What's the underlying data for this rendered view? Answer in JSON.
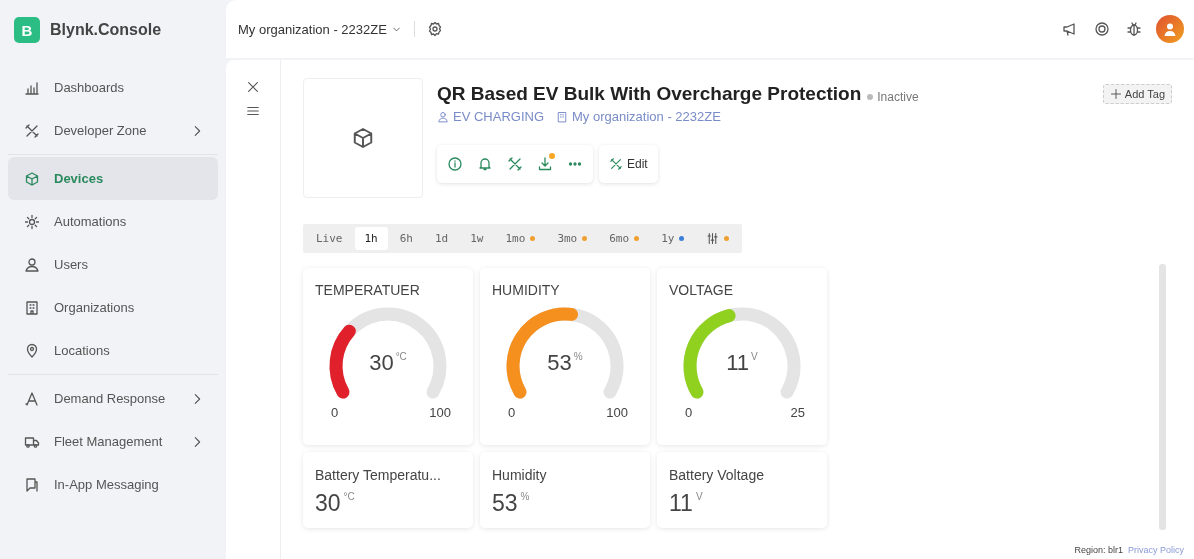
{
  "brand": {
    "logo_letter": "B",
    "name": "Blynk.Console"
  },
  "topbar": {
    "organization": "My organization - 2232ZE"
  },
  "sidebar": {
    "groups": [
      {
        "items": [
          {
            "label": "Dashboards",
            "selected": false,
            "submenu": false
          },
          {
            "label": "Developer Zone",
            "selected": false,
            "submenu": true
          }
        ]
      },
      {
        "items": [
          {
            "label": "Devices",
            "selected": true,
            "submenu": false
          },
          {
            "label": "Automations",
            "selected": false,
            "submenu": false
          },
          {
            "label": "Users",
            "selected": false,
            "submenu": false
          },
          {
            "label": "Organizations",
            "selected": false,
            "submenu": false
          },
          {
            "label": "Locations",
            "selected": false,
            "submenu": false
          }
        ]
      },
      {
        "items": [
          {
            "label": "Demand Response",
            "selected": false,
            "submenu": true
          },
          {
            "label": "Fleet Management",
            "selected": false,
            "submenu": true
          },
          {
            "label": "In-App Messaging",
            "selected": false,
            "submenu": false
          }
        ]
      }
    ]
  },
  "device": {
    "title": "QR Based EV Bulk With Overcharge Protection",
    "status": "Inactive",
    "template": "EV CHARGING",
    "organization": "My organization - 2232ZE",
    "add_tag": "Add Tag",
    "toolbar": [
      {
        "badge": false
      },
      {
        "badge": false
      },
      {
        "badge": false
      },
      {
        "badge": true
      },
      {
        "badge": false
      }
    ],
    "edit": "Edit"
  },
  "time_ranges": [
    {
      "kind": "text",
      "label": "Live",
      "selected": false
    },
    {
      "kind": "text",
      "label": "1h",
      "selected": true
    },
    {
      "kind": "text",
      "label": "6h",
      "selected": false
    },
    {
      "kind": "text",
      "label": "1d",
      "selected": false
    },
    {
      "kind": "text",
      "label": "1w",
      "selected": false
    },
    {
      "kind": "text",
      "label": "1mo",
      "selected": false,
      "color": "#f0a030"
    },
    {
      "kind": "text",
      "label": "3mo",
      "selected": false,
      "color": "#f0a030"
    },
    {
      "kind": "text",
      "label": "6mo",
      "selected": false,
      "color": "#f0a030"
    },
    {
      "kind": "text",
      "label": "1y",
      "selected": false,
      "color": "#3a7fd8"
    },
    {
      "kind": "icon",
      "selected": false,
      "color": "#f0a030"
    }
  ],
  "gauges": [
    {
      "title": "TEMPERATUER",
      "value": "30",
      "unit": "°C",
      "min": "0",
      "max": "100",
      "color": "#e0202a"
    },
    {
      "title": "HUMIDITY",
      "value": "53",
      "unit": "%",
      "min": "0",
      "max": "100",
      "color": "#f5901e"
    },
    {
      "title": "VOLTAGE",
      "value": "11",
      "unit": "V",
      "min": "0",
      "max": "25",
      "color": "#8fd11e"
    }
  ],
  "value_cards": [
    {
      "title": "Battery Temperatu...",
      "value": "30",
      "unit": "°C"
    },
    {
      "title": "Humidity",
      "value": "53",
      "unit": "%"
    },
    {
      "title": "Battery Voltage",
      "value": "11",
      "unit": "V"
    }
  ],
  "footer": {
    "region": "Region: blr1",
    "privacy": "Privacy Policy"
  }
}
